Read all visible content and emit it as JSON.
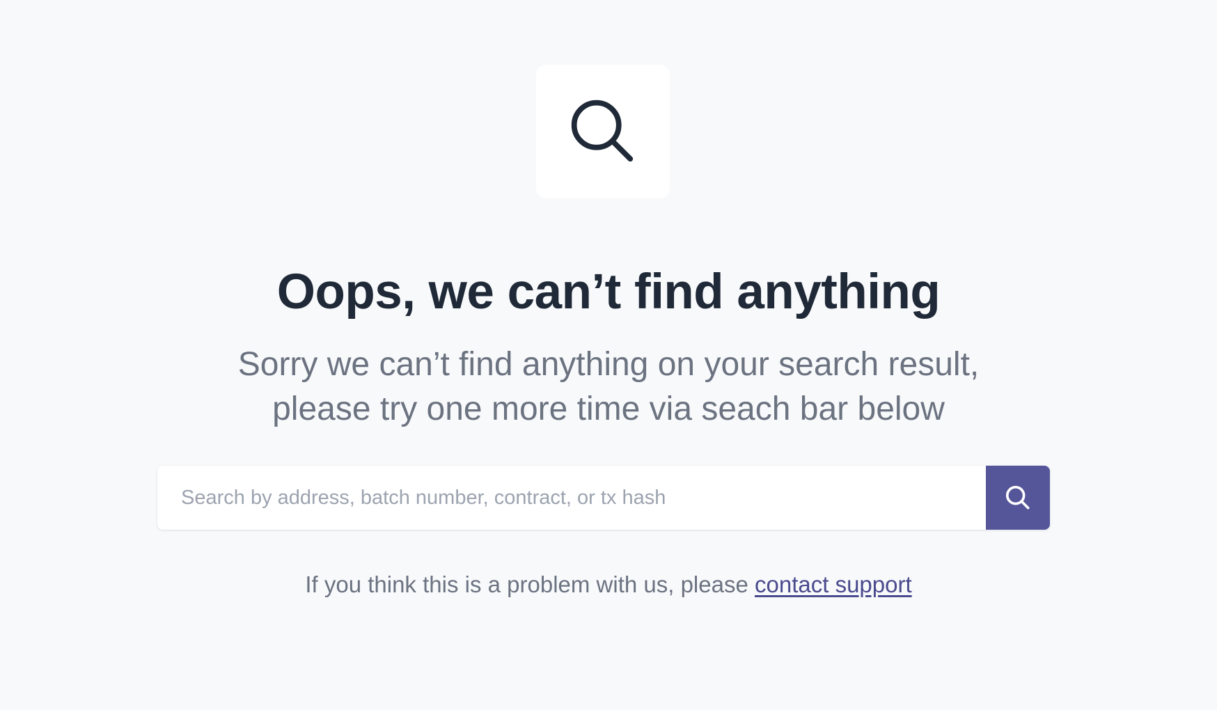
{
  "hero": {
    "icon": "search-icon"
  },
  "title": "Oops, we can’t find anything",
  "subtitle": "Sorry we can’t find anything on your search result, please try one more time via seach bar below",
  "search": {
    "placeholder": "Search by address, batch number, contract, or tx hash",
    "value": "",
    "button_icon": "search-icon"
  },
  "footer": {
    "text": "If you think this is a problem with us, please",
    "link_label": "contact support"
  },
  "colors": {
    "background": "#f8f9fb",
    "accent": "#55559a",
    "link": "#4a4a8e",
    "title": "#1f2937",
    "muted": "#6b7280"
  }
}
